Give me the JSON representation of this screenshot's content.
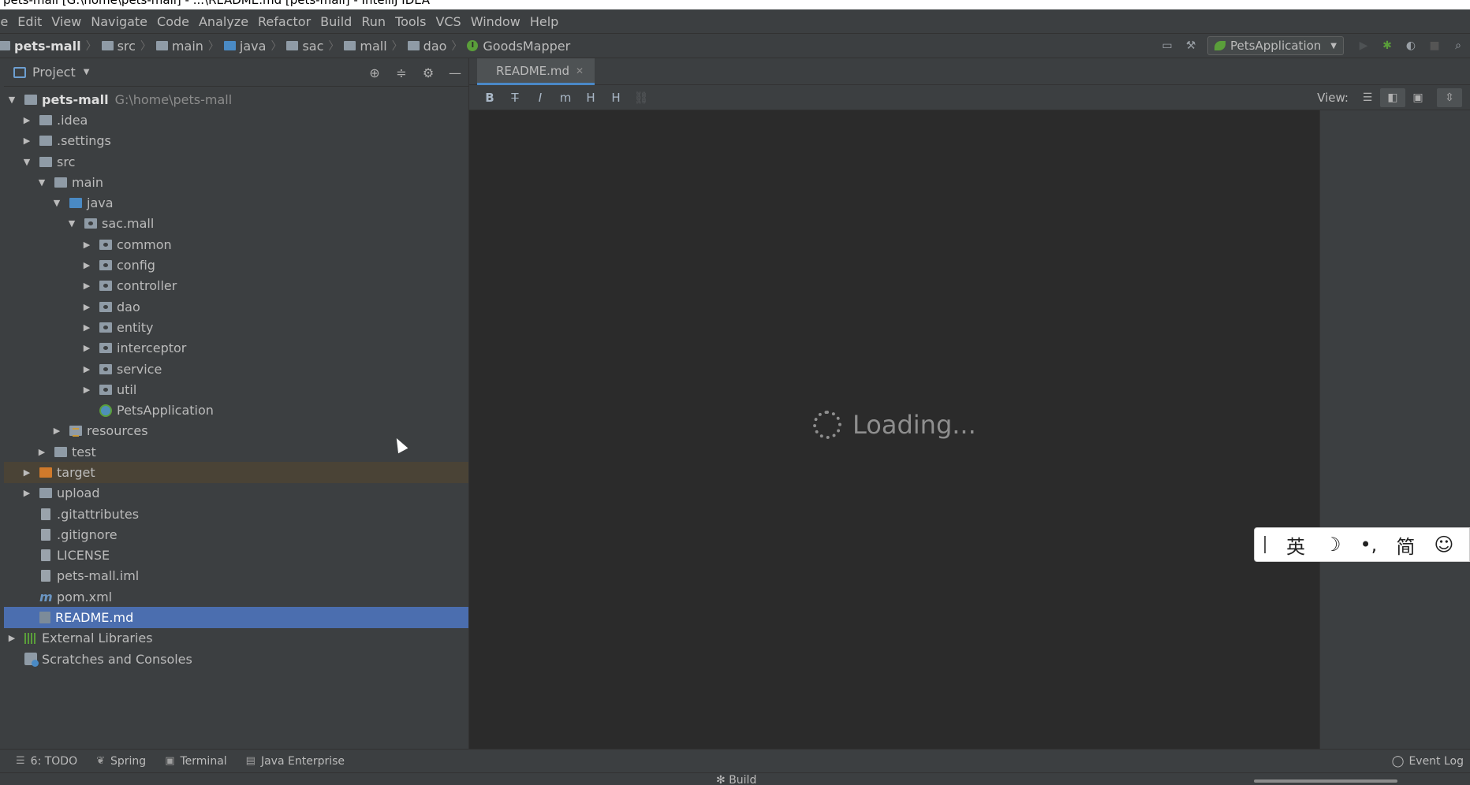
{
  "window": {
    "title": "pets-mall [G:\\home\\pets-mall] - ...\\README.md [pets-mall] - IntelliJ IDEA"
  },
  "menu": [
    "le",
    "Edit",
    "View",
    "Navigate",
    "Code",
    "Analyze",
    "Refactor",
    "Build",
    "Run",
    "Tools",
    "VCS",
    "Window",
    "Help"
  ],
  "breadcrumbs": [
    {
      "label": "pets-mall",
      "icon": "module-folder-icon"
    },
    {
      "label": "src",
      "icon": "folder-icon"
    },
    {
      "label": "main",
      "icon": "folder-icon"
    },
    {
      "label": "java",
      "icon": "source-folder-icon"
    },
    {
      "label": "sac",
      "icon": "package-icon"
    },
    {
      "label": "mall",
      "icon": "package-icon"
    },
    {
      "label": "dao",
      "icon": "package-icon"
    },
    {
      "label": "GoodsMapper",
      "icon": "spring-interface-icon"
    }
  ],
  "run_config": {
    "label": "PetsApplication"
  },
  "project_panel": {
    "title": "Project",
    "tree": [
      {
        "label": "pets-mall",
        "path": "G:\\home\\pets-mall",
        "depth": 0,
        "arrow": "open",
        "icon": "module",
        "bold": true
      },
      {
        "label": ".idea",
        "depth": 1,
        "arrow": "closed",
        "icon": "folder"
      },
      {
        "label": ".settings",
        "depth": 1,
        "arrow": "closed",
        "icon": "folder"
      },
      {
        "label": "src",
        "depth": 1,
        "arrow": "open",
        "icon": "folder"
      },
      {
        "label": "main",
        "depth": 2,
        "arrow": "open",
        "icon": "folder"
      },
      {
        "label": "java",
        "depth": 3,
        "arrow": "open",
        "icon": "folder-blue"
      },
      {
        "label": "sac.mall",
        "depth": 4,
        "arrow": "open",
        "icon": "pkg"
      },
      {
        "label": "common",
        "depth": 5,
        "arrow": "closed",
        "icon": "pkg"
      },
      {
        "label": "config",
        "depth": 5,
        "arrow": "closed",
        "icon": "pkg"
      },
      {
        "label": "controller",
        "depth": 5,
        "arrow": "closed",
        "icon": "pkg"
      },
      {
        "label": "dao",
        "depth": 5,
        "arrow": "closed",
        "icon": "pkg"
      },
      {
        "label": "entity",
        "depth": 5,
        "arrow": "closed",
        "icon": "pkg"
      },
      {
        "label": "interceptor",
        "depth": 5,
        "arrow": "closed",
        "icon": "pkg"
      },
      {
        "label": "service",
        "depth": 5,
        "arrow": "closed",
        "icon": "pkg"
      },
      {
        "label": "util",
        "depth": 5,
        "arrow": "closed",
        "icon": "pkg"
      },
      {
        "label": "PetsApplication",
        "depth": 5,
        "arrow": "none",
        "icon": "spring-app"
      },
      {
        "label": "resources",
        "depth": 3,
        "arrow": "closed",
        "icon": "res"
      },
      {
        "label": "test",
        "depth": 2,
        "arrow": "closed",
        "icon": "folder"
      },
      {
        "label": "target",
        "depth": 1,
        "arrow": "closed",
        "icon": "folder-orange",
        "highlight": "target"
      },
      {
        "label": "upload",
        "depth": 1,
        "arrow": "closed",
        "icon": "folder"
      },
      {
        "label": ".gitattributes",
        "depth": 1,
        "arrow": "none",
        "icon": "file"
      },
      {
        "label": ".gitignore",
        "depth": 1,
        "arrow": "none",
        "icon": "file"
      },
      {
        "label": "LICENSE",
        "depth": 1,
        "arrow": "none",
        "icon": "file"
      },
      {
        "label": "pets-mall.iml",
        "depth": 1,
        "arrow": "none",
        "icon": "file"
      },
      {
        "label": "pom.xml",
        "depth": 1,
        "arrow": "none",
        "icon": "maven"
      },
      {
        "label": "README.md",
        "depth": 1,
        "arrow": "none",
        "icon": "md",
        "selected": true
      },
      {
        "label": "External Libraries",
        "depth": 0,
        "arrow": "closed",
        "icon": "libs"
      },
      {
        "label": "Scratches and Consoles",
        "depth": 0,
        "arrow": "none",
        "icon": "scratch"
      }
    ]
  },
  "editor": {
    "tab_label": "README.md",
    "view_label": "View:",
    "loading_text": "Loading..."
  },
  "ime": {
    "items": [
      "英",
      "☽",
      "•,",
      "简",
      "☺"
    ]
  },
  "bottom_tools": [
    {
      "label": "6: TODO",
      "icon": "todo-icon",
      "glyph": "☰"
    },
    {
      "label": "Spring",
      "icon": "spring-icon",
      "glyph": "❦"
    },
    {
      "label": "Terminal",
      "icon": "terminal-icon",
      "glyph": "▣"
    },
    {
      "label": "Java Enterprise",
      "icon": "java-enterprise-icon",
      "glyph": "▤"
    }
  ],
  "event_log": "Event Log",
  "status": {
    "build_label": "Build"
  },
  "colors": {
    "selection": "#4b6eaf",
    "background": "#2b2b2b",
    "panel": "#3c3f41",
    "accent_green": "#5a9e3a"
  }
}
